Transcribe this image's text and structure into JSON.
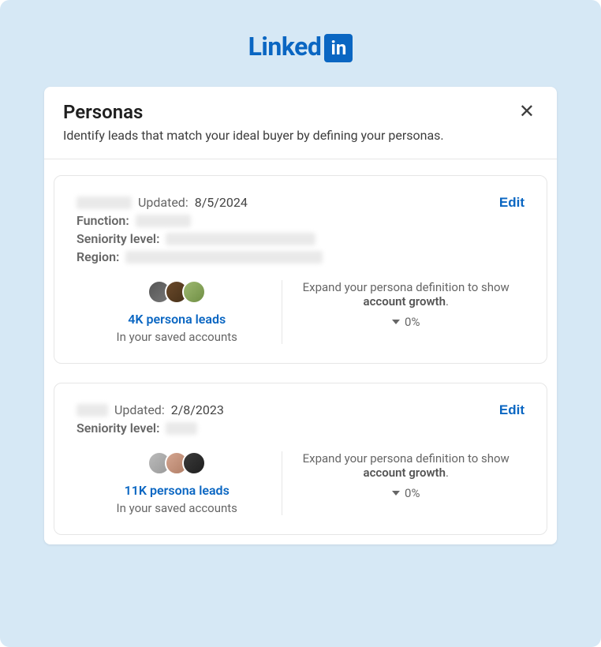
{
  "logo": {
    "text": "Linked",
    "in": "in"
  },
  "header": {
    "title": "Personas",
    "subtitle": "Identify leads that match your ideal buyer by defining your personas."
  },
  "labels": {
    "updated_prefix": "Updated:",
    "function": "Function:",
    "seniority": "Seniority level:",
    "region": "Region:",
    "edit": "Edit",
    "leads_sub": "In your saved accounts",
    "growth_pre": "Expand your persona definition to show ",
    "growth_strong": "account growth",
    "growth_post": "."
  },
  "personas": [
    {
      "updated": "8/5/2024",
      "has_function": true,
      "has_region": true,
      "leads": "4K persona leads",
      "growth_pct": "0%"
    },
    {
      "updated": "2/8/2023",
      "has_function": false,
      "has_region": false,
      "leads": "11K persona leads",
      "growth_pct": "0%"
    }
  ]
}
